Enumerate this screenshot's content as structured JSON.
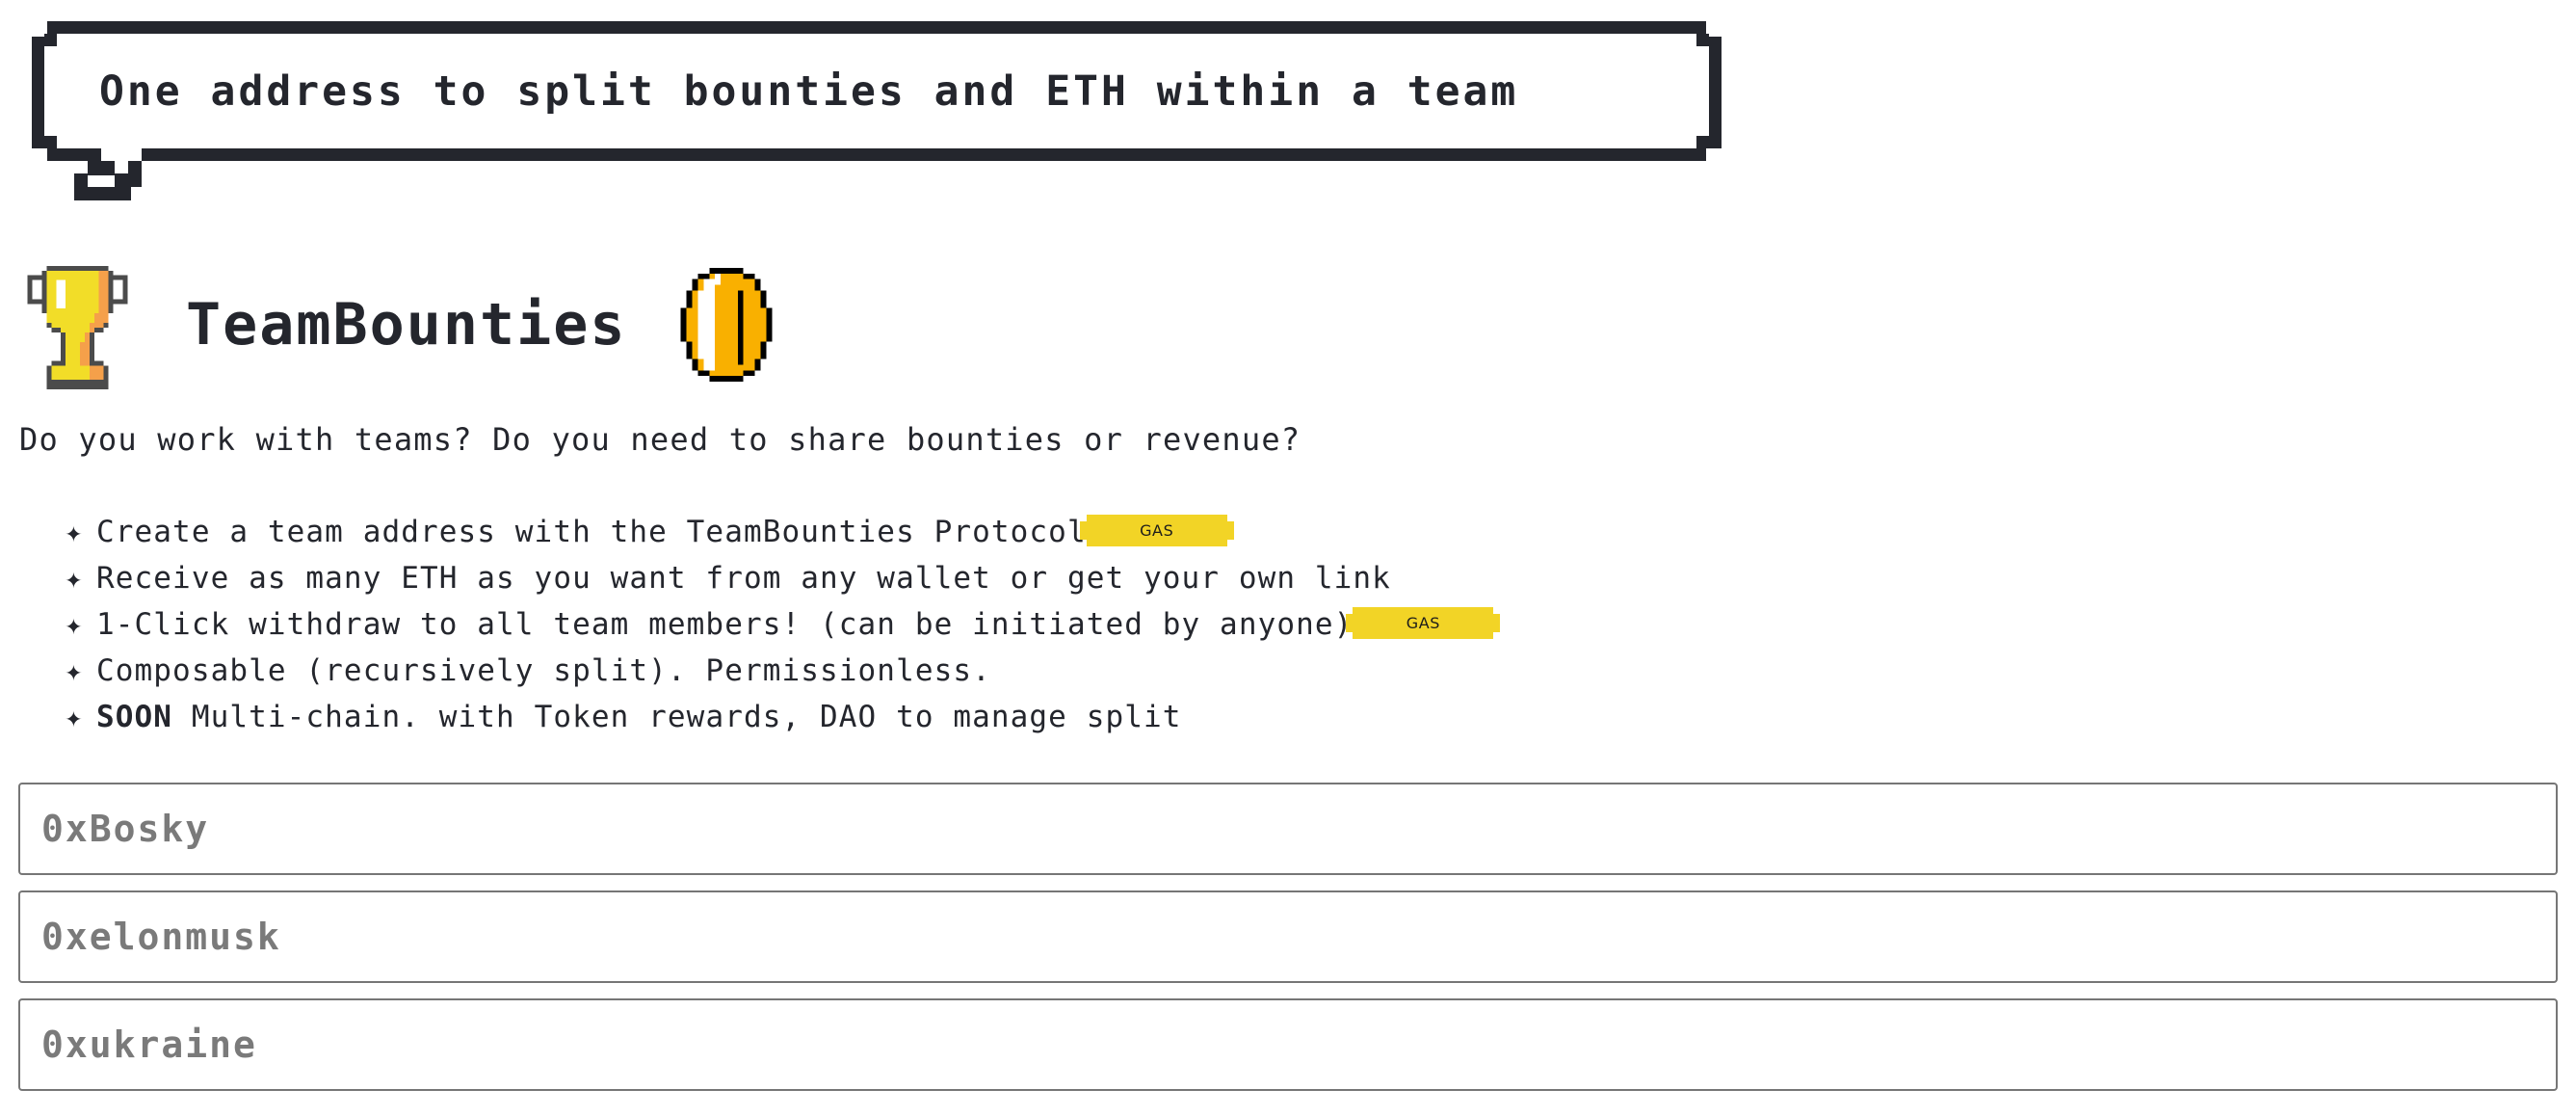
{
  "bubble": {
    "text": "One address to split bounties and ETH within a team"
  },
  "brand": {
    "trophy_icon": "trophy-icon",
    "title": "TeamBounties",
    "coin_icon": "coin-icon"
  },
  "intro": {
    "text": "Do you work with teams? Do you need to share bounties or revenue?"
  },
  "features": {
    "bullet_glyph": "✦",
    "items": [
      {
        "prefix": "",
        "text": "Create a team address with the TeamBounties Protocol",
        "badge": "GAS"
      },
      {
        "prefix": "",
        "text": "Receive as many ETH as you want from any wallet or get your own link",
        "badge": null
      },
      {
        "prefix": "",
        "text": "1-Click withdraw to all team members! (can be initiated by anyone)",
        "badge": "GAS"
      },
      {
        "prefix": "",
        "text": "Composable (recursively split). Permissionless.",
        "badge": null
      },
      {
        "prefix": "SOON",
        "text": " Multi-chain. with Token rewards, DAO to manage split",
        "badge": null
      }
    ]
  },
  "fields": [
    {
      "placeholder": "0xBosky",
      "value": ""
    },
    {
      "placeholder": "0xelonmusk",
      "value": ""
    },
    {
      "placeholder": "0xukraine",
      "value": ""
    }
  ],
  "colors": {
    "ink": "#24262d",
    "gas_yellow": "#f2d426",
    "trophy_yellow": "#f2dd28",
    "trophy_shadow": "#f5a04a",
    "trophy_outline": "#4b4b4b",
    "coin_gold": "#f9b000",
    "coin_outline": "#000000",
    "field_border": "#767676",
    "placeholder": "#7a7a7a"
  }
}
